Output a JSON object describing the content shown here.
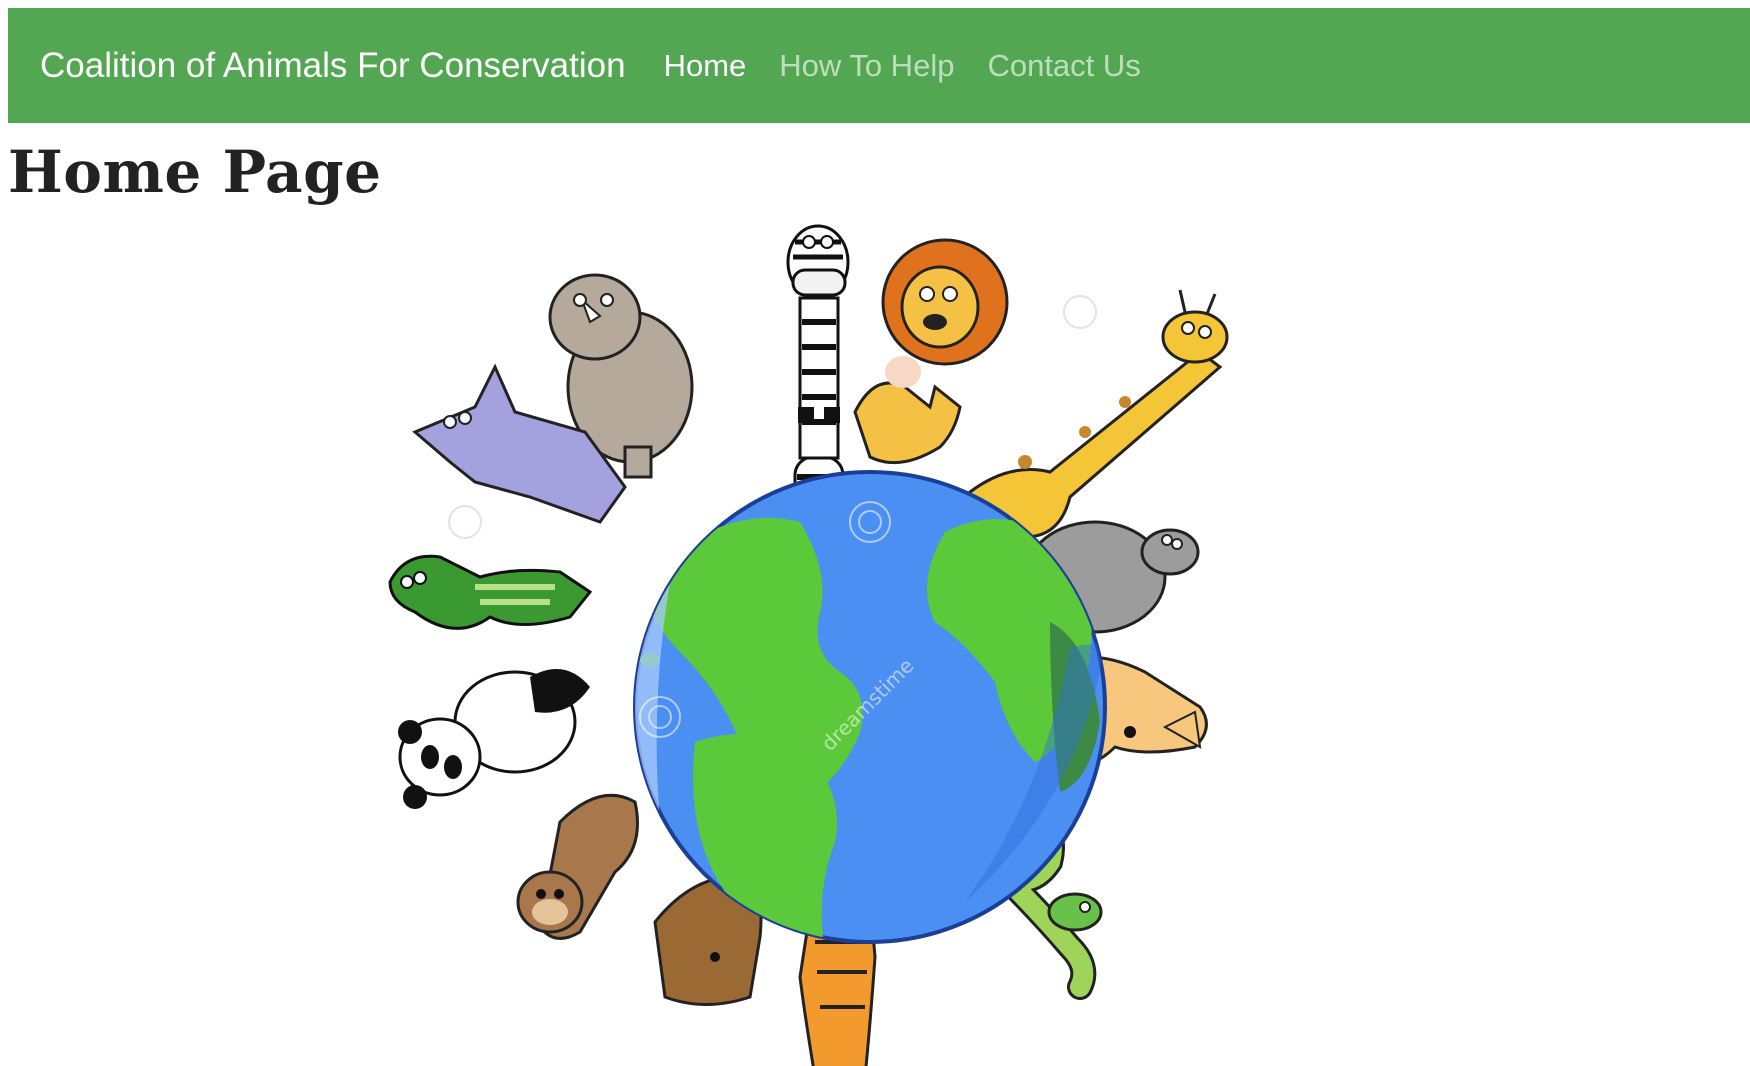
{
  "navbar": {
    "brand": "Coalition of Animals For Conservation",
    "links": [
      {
        "label": "Home",
        "active": true
      },
      {
        "label": "How To Help",
        "active": false
      },
      {
        "label": "Contact Us",
        "active": false
      }
    ],
    "background_color": "#53a753"
  },
  "main": {
    "title": "Home Page",
    "hero_image": {
      "watermark": "dreamstime",
      "colors": {
        "ocean": "#4b8ff2",
        "land": "#5cc93b"
      }
    }
  }
}
